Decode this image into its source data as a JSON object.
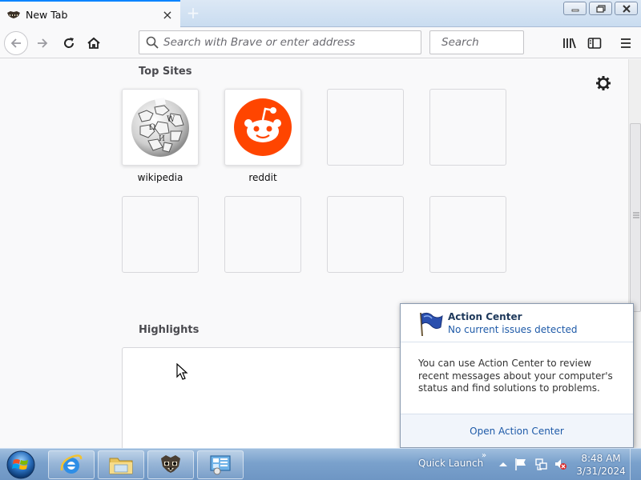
{
  "browser": {
    "tab": {
      "title": "New Tab",
      "favicon": "raccoon-icon",
      "close_icon": "×"
    },
    "new_tab_icon": "+",
    "url_placeholder": "Search with Brave or enter address",
    "search_placeholder": "Search",
    "accent": "#0a84ff"
  },
  "newtab": {
    "top_sites_title": "Top Sites",
    "highlights_title": "Highlights",
    "sites": [
      {
        "label": "wikipedia",
        "icon": "wikipedia-globe-icon"
      },
      {
        "label": "reddit",
        "icon": "reddit-icon",
        "color": "#ff4500"
      }
    ]
  },
  "action_center": {
    "title": "Action Center",
    "subtitle": "No current issues detected",
    "body": "You can use Action Center to review recent messages about your computer's status and find solutions to problems.",
    "link": "Open Action Center"
  },
  "taskbar": {
    "quick_launch": "Quick Launch",
    "chevron": "»",
    "time": "8:48 AM",
    "date": "3/31/2024"
  }
}
